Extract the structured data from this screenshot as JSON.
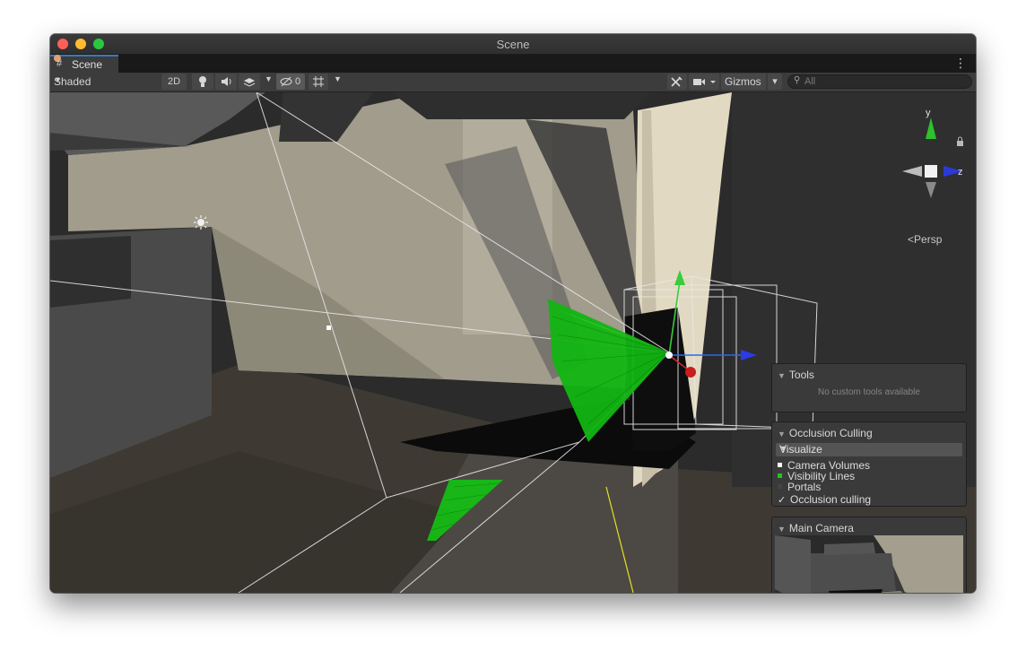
{
  "window": {
    "title": "Scene"
  },
  "tab": {
    "label": "Scene",
    "icon": "scene-grid-icon"
  },
  "toolbar": {
    "shading_mode": "Shaded",
    "mode_2d": "2D",
    "hidden_count": "0",
    "gizmos_label": "Gizmos",
    "search_placeholder": "All"
  },
  "gizmo": {
    "axis_y": "y",
    "axis_z": "z",
    "projection": "Persp"
  },
  "overlays": {
    "tools": {
      "title": "Tools",
      "hint": "No custom tools available"
    },
    "occlusion": {
      "title": "Occlusion Culling",
      "mode": "Visualize",
      "legend": [
        {
          "label": "Camera Volumes",
          "color": "#ffffff"
        },
        {
          "label": "Visibility Lines",
          "color": "#1ec81e"
        },
        {
          "label": "Portals",
          "color": "#444444"
        }
      ],
      "occlusion_label": "Occlusion culling",
      "occlusion_checked": true
    },
    "camera": {
      "title": "Main Camera"
    }
  },
  "colors": {
    "wall": "#a29d8d",
    "floor": "#3e3a34",
    "visibility": "#1ec81e",
    "accent_tab": "#3a79bb"
  }
}
